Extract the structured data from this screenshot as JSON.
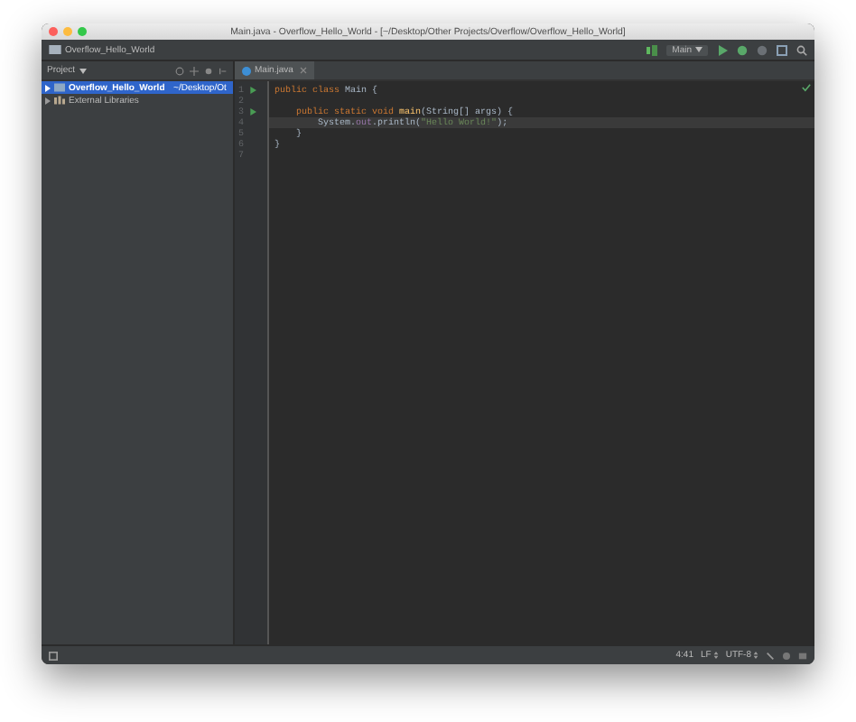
{
  "window": {
    "title": "Main.java - Overflow_Hello_World - [~/Desktop/Other Projects/Overflow/Overflow_Hello_World]"
  },
  "navbar": {
    "breadcrumb": "Overflow_Hello_World",
    "run_config": "Main"
  },
  "project_panel": {
    "title": "Project",
    "items": [
      {
        "label": "Overflow_Hello_World",
        "path": "~/Desktop/Ot",
        "kind": "module",
        "selected": true
      },
      {
        "label": "External Libraries",
        "kind": "library",
        "selected": false
      }
    ]
  },
  "tabs": [
    {
      "label": "Main.java",
      "selected": true
    }
  ],
  "editor": {
    "lines": [
      {
        "number": "1",
        "runnable": true,
        "current": false,
        "tokens": [
          {
            "kind": "keyword",
            "text": "public class "
          },
          {
            "kind": "plain",
            "text": "Main {"
          }
        ]
      },
      {
        "number": "2",
        "runnable": false,
        "current": false
      },
      {
        "number": "3",
        "runnable": true,
        "current": false,
        "tokens": [
          {
            "kind": "keyword",
            "text": "    public static void "
          },
          {
            "kind": "method",
            "text": "main"
          },
          {
            "kind": "plain",
            "text": "(String[] args) {"
          }
        ]
      },
      {
        "number": "4",
        "runnable": false,
        "current": true,
        "tokens": [
          {
            "kind": "plain",
            "text": "        System."
          },
          {
            "kind": "field",
            "text": "out"
          },
          {
            "kind": "plain",
            "text": ".println("
          },
          {
            "kind": "string",
            "text": "\"Hello World!\""
          },
          {
            "kind": "plain",
            "text": ");"
          }
        ]
      },
      {
        "number": "5",
        "runnable": false,
        "current": false,
        "tokens": [
          {
            "kind": "plain",
            "text": "    }"
          }
        ]
      },
      {
        "number": "6",
        "runnable": false,
        "current": false,
        "tokens": [
          {
            "kind": "plain",
            "text": "}"
          }
        ]
      },
      {
        "number": "7",
        "runnable": false,
        "current": false
      }
    ]
  },
  "status_bar": {
    "position": "4:41",
    "line_separator": "LF",
    "encoding": "UTF-8"
  }
}
